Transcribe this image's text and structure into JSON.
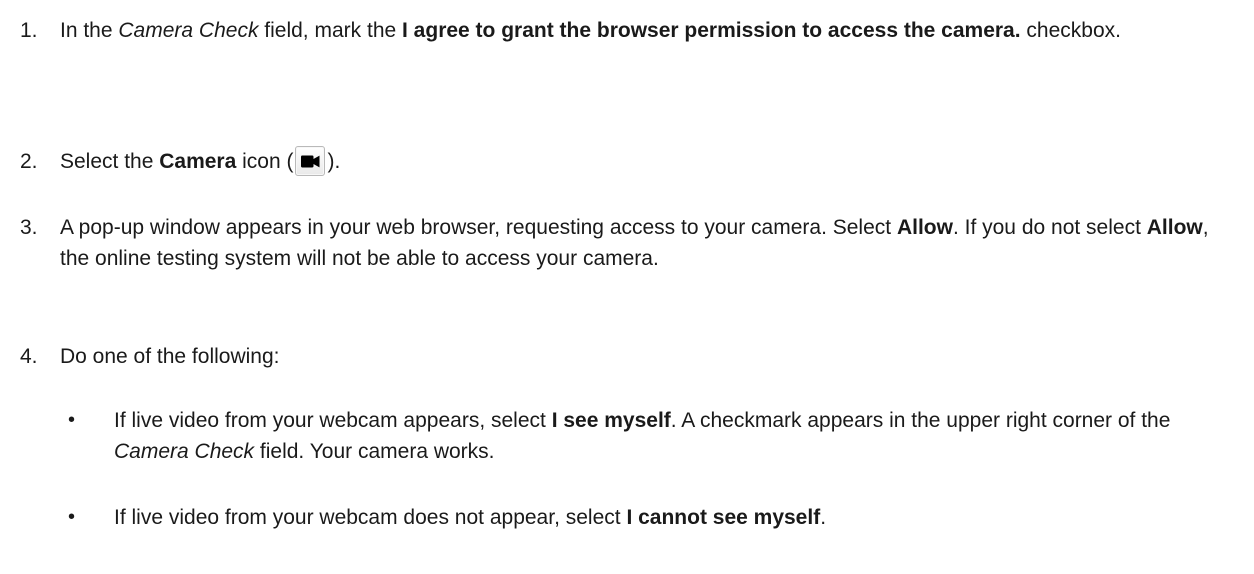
{
  "steps": [
    {
      "number": "1.",
      "p1": "In the ",
      "field": "Camera Check",
      "p2": " field, mark the ",
      "checkbox_label": "I agree to grant the browser permission to access the camera.",
      "p3": " checkbox."
    },
    {
      "number": "2.",
      "p1": "Select the ",
      "icon_label": "Camera",
      "p2": " icon (",
      "icon": "video-camera-icon",
      "p3": ")."
    },
    {
      "number": "3.",
      "p1": "A pop-up window appears in your web browser, requesting access to your camera. Select ",
      "allow1": "Allow",
      "p2": ". If you do not select ",
      "allow2": "Allow",
      "p3": ", the online testing system will not be able to access your camera."
    },
    {
      "number": "4.",
      "text": "Do one of the following:",
      "bullets": [
        {
          "bullet": "•",
          "p1": "If live video from your webcam appears, select ",
          "option": "I see myself",
          "p2": ". A checkmark appears in the upper right corner of the ",
          "field": "Camera Check",
          "p3": " field. Your camera works."
        },
        {
          "bullet": "•",
          "p1": "If live video from your webcam does not appear, select ",
          "option": "I cannot see myself",
          "p2": "."
        }
      ]
    }
  ]
}
